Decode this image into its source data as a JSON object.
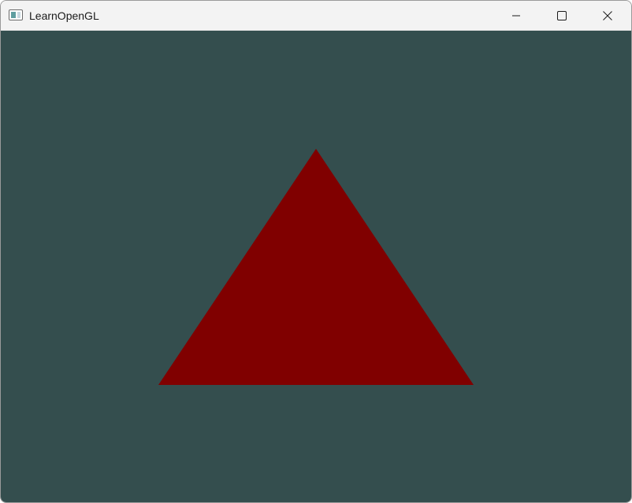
{
  "window": {
    "title": "LearnOpenGL",
    "icons": {
      "app": "window-app-icon",
      "minimize": "minimize-icon",
      "maximize": "maximize-icon",
      "close": "close-icon"
    }
  },
  "scene": {
    "clear_color": "#344e4e",
    "triangle_color": "#800000"
  }
}
